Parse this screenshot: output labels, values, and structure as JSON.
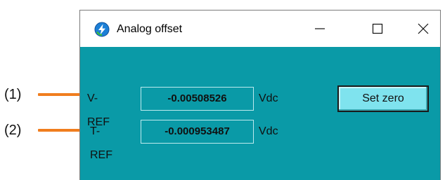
{
  "callouts": [
    {
      "label": "(1)",
      "color": "#f07d1e"
    },
    {
      "label": "(2)",
      "color": "#f07d1e"
    }
  ],
  "window": {
    "title": "Analog offset",
    "icon": "power-bolt-icon",
    "controls": [
      "minimize-icon",
      "maximize-icon",
      "close-icon"
    ],
    "background": "#0a9aa7"
  },
  "fields": {
    "vref": {
      "label": "V-REF",
      "value": "-0.00508526",
      "unit": "Vdc"
    },
    "tref": {
      "label": "T-REF",
      "value": "-0.000953487",
      "unit": "Vdc"
    }
  },
  "buttons": {
    "set_zero": "Set zero"
  }
}
